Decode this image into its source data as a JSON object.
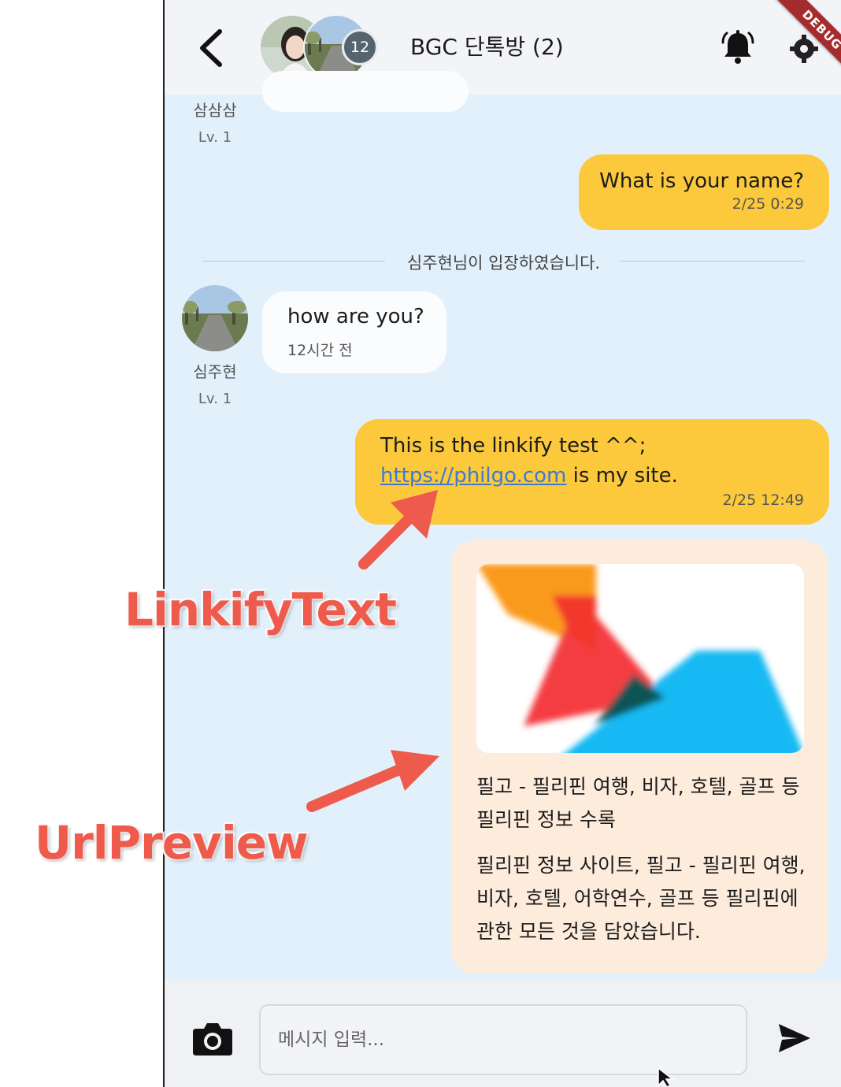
{
  "header": {
    "title": "BGC 단톡방 (2)",
    "member_count": "12",
    "debug_label": "DEBUG"
  },
  "messages": {
    "first_sender": {
      "name": "삼삼삼",
      "level": "Lv. 1"
    },
    "outgoing_1": {
      "text": "What is your name?",
      "time": "2/25 0:29"
    },
    "system_notice": "심주현님이 입장하였습니다.",
    "incoming_1": {
      "sender": "심주현",
      "level": "Lv. 1",
      "text": "how are you?",
      "time": "12시간 전"
    },
    "outgoing_2": {
      "text_line1": "This is the linkify test ^^;",
      "link": "https://philgo.com",
      "text_after_link": " is my site.",
      "time": "2/25 12:49"
    },
    "url_preview": {
      "title": "필고 - 필리핀 여행, 비자, 호텔, 골프 등 필리핀 정보 수록",
      "description": "필리핀 정보 사이트, 필고 - 필리핀 여행, 비자, 호텔, 어학연수, 골프 등 필리핀에 관한 모든 것을 담았습니다."
    }
  },
  "input_bar": {
    "placeholder": "메시지 입력..."
  },
  "annotations": {
    "linkify": "LinkifyText",
    "url_preview": "UrlPreview"
  },
  "colors": {
    "chat_background": "#e2f0fb",
    "outgoing_bubble": "#fbc93b",
    "preview_card": "#fdebdc",
    "annotation": "#ee5a4b",
    "link": "#3a7bd5"
  },
  "icons": [
    "back-icon",
    "bell-icon",
    "gear-icon",
    "camera-icon",
    "send-icon"
  ]
}
